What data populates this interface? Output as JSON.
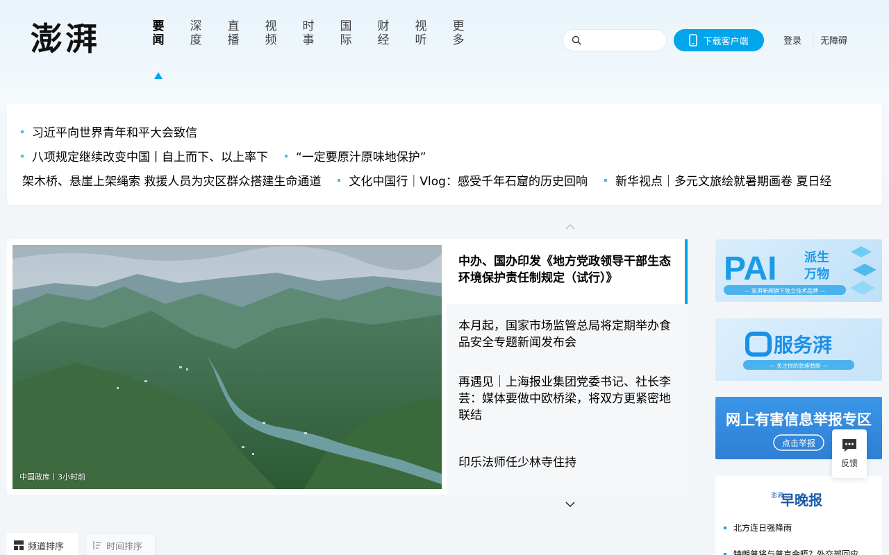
{
  "header": {
    "logo_text": "澎湃",
    "nav": [
      {
        "label": "要闻",
        "active": true
      },
      {
        "label": "深度",
        "active": false
      },
      {
        "label": "直播",
        "active": false
      },
      {
        "label": "视频",
        "active": false
      },
      {
        "label": "时事",
        "active": false
      },
      {
        "label": "国际",
        "active": false
      },
      {
        "label": "财经",
        "active": false
      },
      {
        "label": "视听",
        "active": false
      },
      {
        "label": "更多",
        "active": false
      }
    ],
    "search_placeholder": "",
    "download_label": "下载客户端",
    "login_label": "登录",
    "accessibility_label": "无障碍",
    "accent_color": "#00a5eb"
  },
  "headlines": {
    "row1": [
      "习近平向世界青年和平大会致信"
    ],
    "row2": [
      "八项规定继续改变中国丨自上而下、以上率下",
      "“一定要原汁原味地保护”"
    ],
    "row3": [
      "架木桥、悬崖上架绳索 救援人员为灾区群众搭建生命通道",
      "文化中国行｜Vlog：感受千年石窟的历史回响",
      "新华视点｜多元文旅绘就暑期画卷 夏日经"
    ]
  },
  "feature": {
    "image_caption": "中国政库丨3小时前",
    "title": "中办、国办印发《地方党政领导干部生态环境保护责任制规定（试行）》",
    "side_items": [
      "本月起，国家市场监管总局将定期举办食品安全专题新闻发布会",
      "再遇见｜上海报业集团党委书记、社长李芸：媒体要做中欧桥梁，将双方更紧密地联结",
      "印乐法师任少林寺住持"
    ]
  },
  "ads": {
    "ad1_title": "PAI",
    "ad1_sub1": "派生",
    "ad1_sub2": "万物",
    "ad1_tag": "— 澎湃新闻旗下独立技术品牌 —",
    "ad2_title": "服务湃",
    "ad2_tag": "— 关注你的急难愁盼 —",
    "ad3_title": "网上有害信息举报专区",
    "ad3_button": "点击举报"
  },
  "evening": {
    "logo_small": "澎湃",
    "logo_main": "早晚报",
    "items": [
      "北方连日强降雨",
      "特朗普将与普京会晤？外交部回应"
    ]
  },
  "feedback_label": "反馈",
  "sort": {
    "channel_label": "频道排序",
    "time_label": "时间排序"
  }
}
